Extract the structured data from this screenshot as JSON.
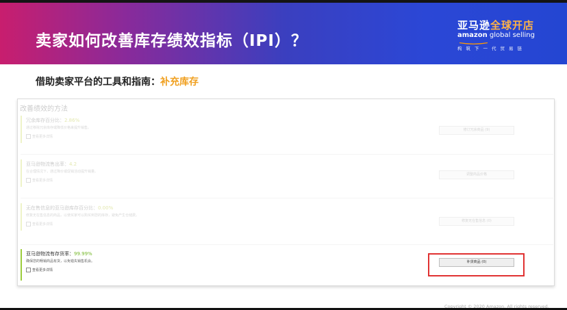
{
  "header": {
    "title": "卖家如何改善库存绩效指标（IPI）？",
    "logo": {
      "cn_main": "亚马逊",
      "cn_accent": "全球开店",
      "en_bold": "amazon",
      "en_rest": " global selling",
      "tagline": "构筑下一代贸易链"
    }
  },
  "subtitle": {
    "prefix": "借助卖家平台的工具和指南：",
    "highlight": "补充库存"
  },
  "card": {
    "title": "改善绩效的方法",
    "sections": [
      {
        "name": "冗余库存百分比：",
        "value": "2.86%",
        "desc": "通过移除冗余库存或降低价格来提升销售。",
        "detail_label": "查看更多详情",
        "action_label": "修订冗余商品 (9)"
      },
      {
        "name": "亚马逊物流售出率：",
        "value": "4.2",
        "desc": "在合理情况下，通过降价或促销活动提升销量。",
        "detail_label": "查看更多详情",
        "action_label": "调整商品价格"
      },
      {
        "name": "无在售信息的亚马逊库存百分比：",
        "value": "0.00%",
        "desc": "修复无在售信息的商品，以使买家可以购买到您的库存，避免产生仓储费。",
        "detail_label": "查看更多详情",
        "action_label": "修复无在售信息 (0)"
      },
      {
        "name": "亚马逊物流有存货率：",
        "value": "99.99%",
        "desc": "确保您的畅销商品有货，以免错失销售机会。",
        "detail_label": "查看更多详情",
        "action_label": "补货商品 (0)"
      }
    ]
  },
  "footer": {
    "copyright": "Copyright © 2020 Amazon. All rights reserved."
  },
  "colors": {
    "highlight_orange": "#f0a020",
    "active_green": "#76b82a",
    "highlight_box_red": "#e03030"
  }
}
